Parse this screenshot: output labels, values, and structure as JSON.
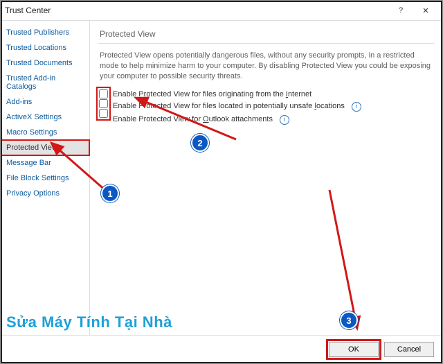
{
  "window": {
    "title": "Trust Center"
  },
  "titlebar": {
    "help": "?",
    "close": "✕"
  },
  "sidebar": {
    "items": [
      {
        "label": "Trusted Publishers"
      },
      {
        "label": "Trusted Locations"
      },
      {
        "label": "Trusted Documents"
      },
      {
        "label": "Trusted Add-in Catalogs"
      },
      {
        "label": "Add-ins"
      },
      {
        "label": "ActiveX Settings"
      },
      {
        "label": "Macro Settings"
      },
      {
        "label": "Protected View"
      },
      {
        "label": "Message Bar"
      },
      {
        "label": "File Block Settings"
      },
      {
        "label": "Privacy Options"
      }
    ],
    "selected_index": 7
  },
  "content": {
    "heading": "Protected View",
    "description": "Protected View opens potentially dangerous files, without any security prompts, in a restricted mode to help minimize harm to your computer. By disabling Protected View you could be exposing your computer to possible security threats.",
    "options": [
      {
        "pre": "Enable Protected View for files originating from the ",
        "u": "I",
        "post": "nternet",
        "info": false
      },
      {
        "pre": "Enable Protected View for files located in potentially unsafe ",
        "u": "l",
        "post": "ocations",
        "info": true
      },
      {
        "pre": "Enable Protected View for ",
        "u": "O",
        "post": "utlook attachments",
        "info": true
      }
    ]
  },
  "footer": {
    "ok": "OK",
    "cancel": "Cancel"
  },
  "annotations": {
    "b1": "1",
    "b2": "2",
    "b3": "3"
  },
  "watermark": "Sửa Máy Tính Tại Nhà"
}
